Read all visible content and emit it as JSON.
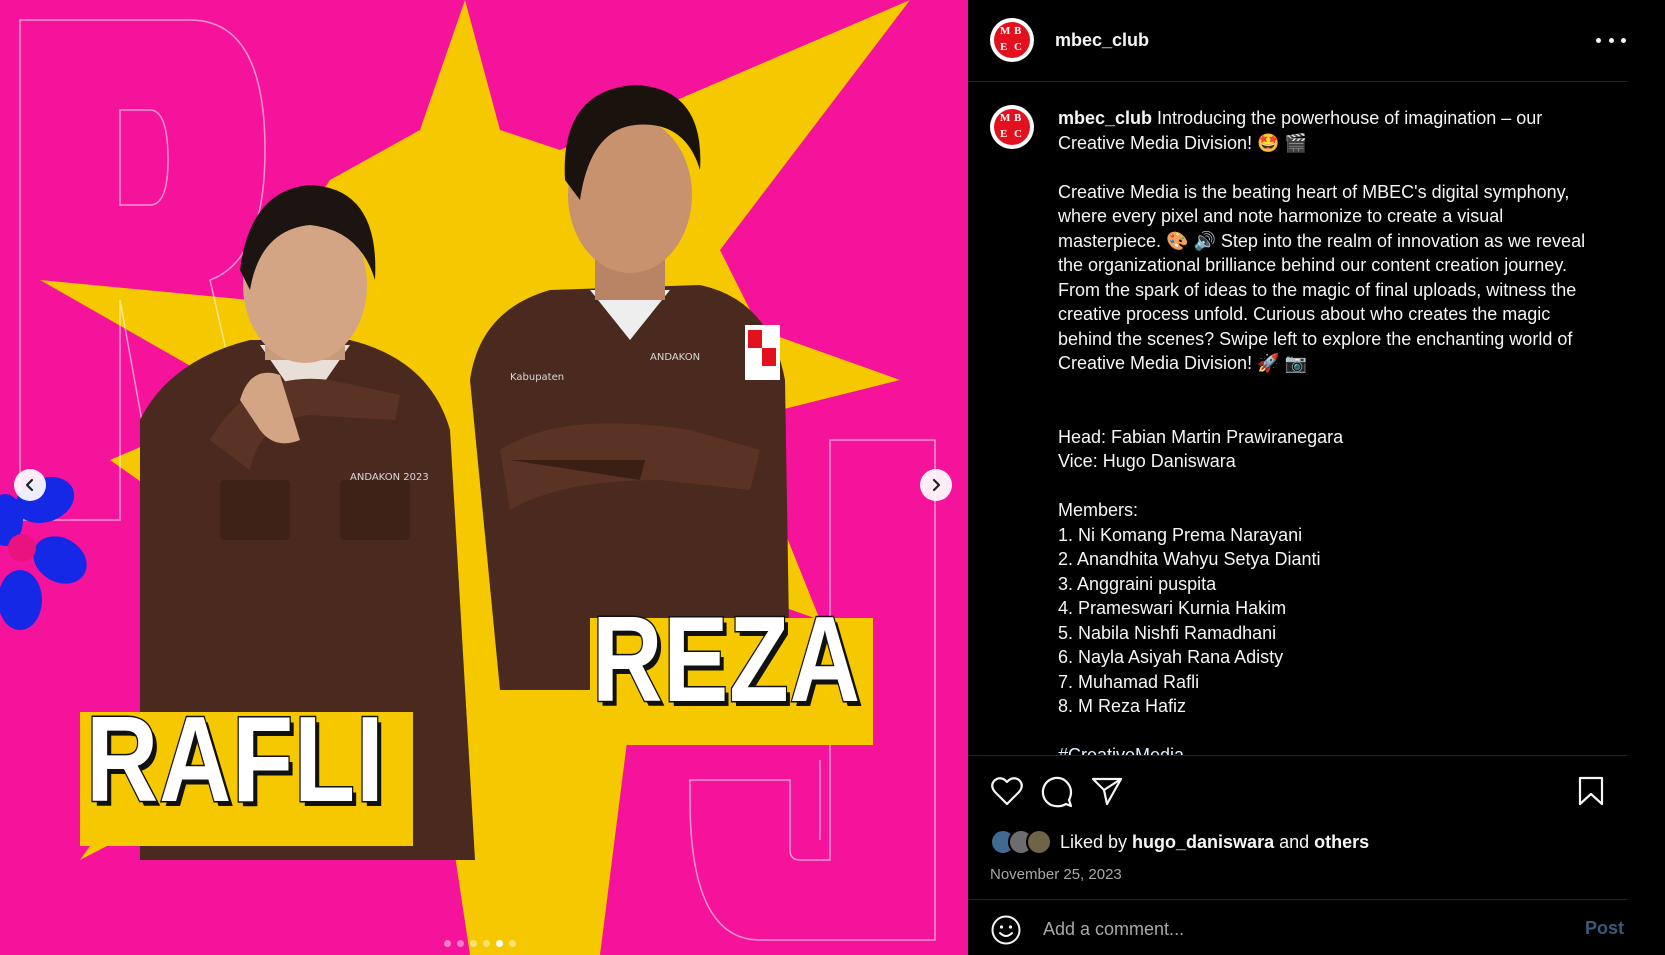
{
  "colors": {
    "media_background": "#f5139b",
    "burst": "#f5c800",
    "banner": "#f5c800",
    "flower": "#1428e6",
    "shirt": "#4a2a1f",
    "logo_red": "#e3101d",
    "post_link_disabled": "#3b5b7a"
  },
  "media": {
    "names": [
      "RAFLI",
      "REZA"
    ],
    "carousel_dot_count": 6,
    "active_dot_index": 4,
    "prev_icon": "chevron-left-icon",
    "next_icon": "chevron-right-icon"
  },
  "header": {
    "username": "mbec_club",
    "avatar_letters": [
      "M",
      "B",
      "E",
      "C"
    ]
  },
  "caption": {
    "username": "mbec_club",
    "intro": " Introducing the powerhouse of imagination – our Creative Media Division! 🤩 🎬",
    "body": "Creative Media is the beating heart of MBEC's digital symphony, where every pixel and note harmonize to create a visual masterpiece. 🎨 🔊 Step into the realm of innovation as we reveal the organizational brilliance behind our content creation journey. From the spark of ideas to the magic of final uploads, witness the creative process unfold. Curious about who creates the magic behind the scenes? Swipe left to explore the enchanting world of Creative Media Division! 🚀 📷",
    "head": "Head: Fabian Martin Prawiranegara",
    "vice": "Vice: Hugo Daniswara",
    "members_title": "Members:",
    "members": [
      "1. Ni Komang Prema Narayani",
      "2. Anandhita Wahyu Setya Dianti",
      "3. Anggraini puspita",
      "4. Prameswari Kurnia Hakim",
      "5. Nabila Nishfi Ramadhani",
      "6. Nayla Asiyah Rana Adisty",
      "7. Muhamad Rafli",
      "8. M Reza Hafiz"
    ],
    "hashtag": "#CreativeMedia"
  },
  "actions": {
    "like_icon": "heart-icon",
    "comment_icon": "comment-bubble-icon",
    "share_icon": "paper-plane-icon",
    "save_icon": "bookmark-icon"
  },
  "likes": {
    "prefix": "Liked by ",
    "user": "hugo_daniswara",
    "middle": " and ",
    "others": "others"
  },
  "date": "November 25, 2023",
  "comment": {
    "placeholder": "Add a comment...",
    "post_label": "Post",
    "emoji_icon": "smiley-icon"
  }
}
